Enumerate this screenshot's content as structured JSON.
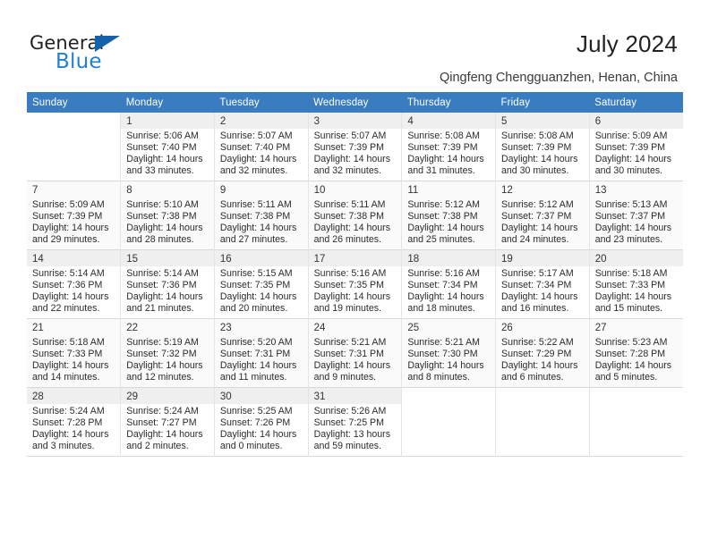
{
  "brand": {
    "name_part1": "General",
    "name_part2": "Blue",
    "triangle_color": "#1263ac",
    "blue_color": "#1f7fd4"
  },
  "header": {
    "title": "July 2024",
    "location": "Qingfeng Chengguanzhen, Henan, China"
  },
  "theme": {
    "header_row_bg": "#3A7CC0",
    "header_row_text": "#FFFFFF",
    "alt_row_bg": "#FAFAFA",
    "day_number_band_bg": "#EFEFEF",
    "grid_line": "#D8D8D8"
  },
  "calendar": {
    "weekdays": [
      "Sunday",
      "Monday",
      "Tuesday",
      "Wednesday",
      "Thursday",
      "Friday",
      "Saturday"
    ],
    "weeks": [
      [
        {
          "empty": true
        },
        {
          "day": "1",
          "sunrise": "Sunrise: 5:06 AM",
          "sunset": "Sunset: 7:40 PM",
          "daylight1": "Daylight: 14 hours",
          "daylight2": "and 33 minutes."
        },
        {
          "day": "2",
          "sunrise": "Sunrise: 5:07 AM",
          "sunset": "Sunset: 7:40 PM",
          "daylight1": "Daylight: 14 hours",
          "daylight2": "and 32 minutes."
        },
        {
          "day": "3",
          "sunrise": "Sunrise: 5:07 AM",
          "sunset": "Sunset: 7:39 PM",
          "daylight1": "Daylight: 14 hours",
          "daylight2": "and 32 minutes."
        },
        {
          "day": "4",
          "sunrise": "Sunrise: 5:08 AM",
          "sunset": "Sunset: 7:39 PM",
          "daylight1": "Daylight: 14 hours",
          "daylight2": "and 31 minutes."
        },
        {
          "day": "5",
          "sunrise": "Sunrise: 5:08 AM",
          "sunset": "Sunset: 7:39 PM",
          "daylight1": "Daylight: 14 hours",
          "daylight2": "and 30 minutes."
        },
        {
          "day": "6",
          "sunrise": "Sunrise: 5:09 AM",
          "sunset": "Sunset: 7:39 PM",
          "daylight1": "Daylight: 14 hours",
          "daylight2": "and 30 minutes."
        }
      ],
      [
        {
          "day": "7",
          "sunrise": "Sunrise: 5:09 AM",
          "sunset": "Sunset: 7:39 PM",
          "daylight1": "Daylight: 14 hours",
          "daylight2": "and 29 minutes."
        },
        {
          "day": "8",
          "sunrise": "Sunrise: 5:10 AM",
          "sunset": "Sunset: 7:38 PM",
          "daylight1": "Daylight: 14 hours",
          "daylight2": "and 28 minutes."
        },
        {
          "day": "9",
          "sunrise": "Sunrise: 5:11 AM",
          "sunset": "Sunset: 7:38 PM",
          "daylight1": "Daylight: 14 hours",
          "daylight2": "and 27 minutes."
        },
        {
          "day": "10",
          "sunrise": "Sunrise: 5:11 AM",
          "sunset": "Sunset: 7:38 PM",
          "daylight1": "Daylight: 14 hours",
          "daylight2": "and 26 minutes."
        },
        {
          "day": "11",
          "sunrise": "Sunrise: 5:12 AM",
          "sunset": "Sunset: 7:38 PM",
          "daylight1": "Daylight: 14 hours",
          "daylight2": "and 25 minutes."
        },
        {
          "day": "12",
          "sunrise": "Sunrise: 5:12 AM",
          "sunset": "Sunset: 7:37 PM",
          "daylight1": "Daylight: 14 hours",
          "daylight2": "and 24 minutes."
        },
        {
          "day": "13",
          "sunrise": "Sunrise: 5:13 AM",
          "sunset": "Sunset: 7:37 PM",
          "daylight1": "Daylight: 14 hours",
          "daylight2": "and 23 minutes."
        }
      ],
      [
        {
          "day": "14",
          "sunrise": "Sunrise: 5:14 AM",
          "sunset": "Sunset: 7:36 PM",
          "daylight1": "Daylight: 14 hours",
          "daylight2": "and 22 minutes."
        },
        {
          "day": "15",
          "sunrise": "Sunrise: 5:14 AM",
          "sunset": "Sunset: 7:36 PM",
          "daylight1": "Daylight: 14 hours",
          "daylight2": "and 21 minutes."
        },
        {
          "day": "16",
          "sunrise": "Sunrise: 5:15 AM",
          "sunset": "Sunset: 7:35 PM",
          "daylight1": "Daylight: 14 hours",
          "daylight2": "and 20 minutes."
        },
        {
          "day": "17",
          "sunrise": "Sunrise: 5:16 AM",
          "sunset": "Sunset: 7:35 PM",
          "daylight1": "Daylight: 14 hours",
          "daylight2": "and 19 minutes."
        },
        {
          "day": "18",
          "sunrise": "Sunrise: 5:16 AM",
          "sunset": "Sunset: 7:34 PM",
          "daylight1": "Daylight: 14 hours",
          "daylight2": "and 18 minutes."
        },
        {
          "day": "19",
          "sunrise": "Sunrise: 5:17 AM",
          "sunset": "Sunset: 7:34 PM",
          "daylight1": "Daylight: 14 hours",
          "daylight2": "and 16 minutes."
        },
        {
          "day": "20",
          "sunrise": "Sunrise: 5:18 AM",
          "sunset": "Sunset: 7:33 PM",
          "daylight1": "Daylight: 14 hours",
          "daylight2": "and 15 minutes."
        }
      ],
      [
        {
          "day": "21",
          "sunrise": "Sunrise: 5:18 AM",
          "sunset": "Sunset: 7:33 PM",
          "daylight1": "Daylight: 14 hours",
          "daylight2": "and 14 minutes."
        },
        {
          "day": "22",
          "sunrise": "Sunrise: 5:19 AM",
          "sunset": "Sunset: 7:32 PM",
          "daylight1": "Daylight: 14 hours",
          "daylight2": "and 12 minutes."
        },
        {
          "day": "23",
          "sunrise": "Sunrise: 5:20 AM",
          "sunset": "Sunset: 7:31 PM",
          "daylight1": "Daylight: 14 hours",
          "daylight2": "and 11 minutes."
        },
        {
          "day": "24",
          "sunrise": "Sunrise: 5:21 AM",
          "sunset": "Sunset: 7:31 PM",
          "daylight1": "Daylight: 14 hours",
          "daylight2": "and 9 minutes."
        },
        {
          "day": "25",
          "sunrise": "Sunrise: 5:21 AM",
          "sunset": "Sunset: 7:30 PM",
          "daylight1": "Daylight: 14 hours",
          "daylight2": "and 8 minutes."
        },
        {
          "day": "26",
          "sunrise": "Sunrise: 5:22 AM",
          "sunset": "Sunset: 7:29 PM",
          "daylight1": "Daylight: 14 hours",
          "daylight2": "and 6 minutes."
        },
        {
          "day": "27",
          "sunrise": "Sunrise: 5:23 AM",
          "sunset": "Sunset: 7:28 PM",
          "daylight1": "Daylight: 14 hours",
          "daylight2": "and 5 minutes."
        }
      ],
      [
        {
          "day": "28",
          "sunrise": "Sunrise: 5:24 AM",
          "sunset": "Sunset: 7:28 PM",
          "daylight1": "Daylight: 14 hours",
          "daylight2": "and 3 minutes."
        },
        {
          "day": "29",
          "sunrise": "Sunrise: 5:24 AM",
          "sunset": "Sunset: 7:27 PM",
          "daylight1": "Daylight: 14 hours",
          "daylight2": "and 2 minutes."
        },
        {
          "day": "30",
          "sunrise": "Sunrise: 5:25 AM",
          "sunset": "Sunset: 7:26 PM",
          "daylight1": "Daylight: 14 hours",
          "daylight2": "and 0 minutes."
        },
        {
          "day": "31",
          "sunrise": "Sunrise: 5:26 AM",
          "sunset": "Sunset: 7:25 PM",
          "daylight1": "Daylight: 13 hours",
          "daylight2": "and 59 minutes."
        },
        {
          "empty": true
        },
        {
          "empty": true
        },
        {
          "empty": true
        }
      ]
    ]
  }
}
